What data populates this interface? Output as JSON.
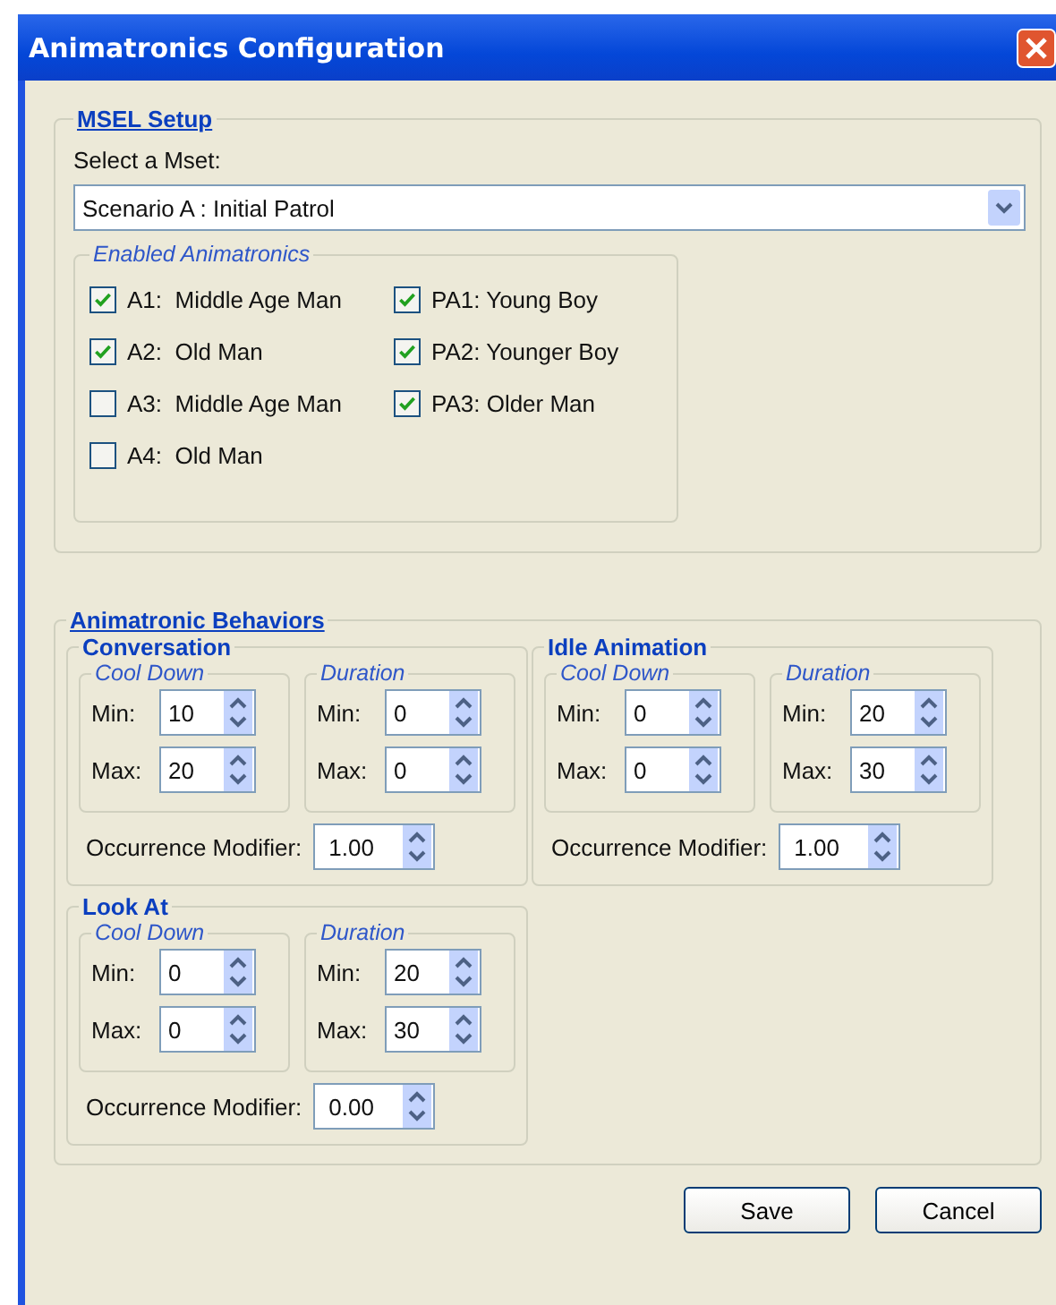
{
  "window": {
    "title": "Animatronics Configuration"
  },
  "msel_setup": {
    "title": "MSEL Setup",
    "select_label": "Select a Mset:",
    "select_value": "Scenario A : Initial Patrol",
    "enabled_title": "Enabled Animatronics",
    "animatronics": [
      {
        "label": "A1:  Middle Age Man",
        "checked": true
      },
      {
        "label": "A2:  Old Man",
        "checked": true
      },
      {
        "label": "A3:  Middle Age Man",
        "checked": false
      },
      {
        "label": "A4:  Old Man",
        "checked": false
      },
      {
        "label": "PA1: Young Boy",
        "checked": true
      },
      {
        "label": "PA2: Younger Boy",
        "checked": true
      },
      {
        "label": "PA3: Older Man",
        "checked": true
      }
    ]
  },
  "behaviors": {
    "title": "Animatronic Behaviors",
    "groups": [
      {
        "title": "Conversation",
        "subgroups": [
          {
            "title": "Cool Down",
            "fields": [
              {
                "label": "Min:",
                "value": "10"
              },
              {
                "label": "Max:",
                "value": "20"
              }
            ]
          },
          {
            "title": "Duration",
            "fields": [
              {
                "label": "Min:",
                "value": "0"
              },
              {
                "label": "Max:",
                "value": "0"
              }
            ]
          }
        ],
        "modifier": {
          "label": "Occurrence Modifier:",
          "value": "1.00"
        }
      },
      {
        "title": "Idle Animation",
        "subgroups": [
          {
            "title": "Cool Down",
            "fields": [
              {
                "label": "Min:",
                "value": "0"
              },
              {
                "label": "Max:",
                "value": "0"
              }
            ]
          },
          {
            "title": "Duration",
            "fields": [
              {
                "label": "Min:",
                "value": "20"
              },
              {
                "label": "Max:",
                "value": "30"
              }
            ]
          }
        ],
        "modifier": {
          "label": "Occurrence Modifier:",
          "value": "1.00"
        }
      },
      {
        "title": "Look At",
        "subgroups": [
          {
            "title": "Cool Down",
            "fields": [
              {
                "label": "Min:",
                "value": "0"
              },
              {
                "label": "Max:",
                "value": "0"
              }
            ]
          },
          {
            "title": "Duration",
            "fields": [
              {
                "label": "Min:",
                "value": "20"
              },
              {
                "label": "Max:",
                "value": "30"
              }
            ]
          }
        ],
        "modifier": {
          "label": "Occurrence Modifier:",
          "value": "0.00"
        }
      }
    ]
  },
  "buttons": [
    "Save",
    "Cancel"
  ]
}
